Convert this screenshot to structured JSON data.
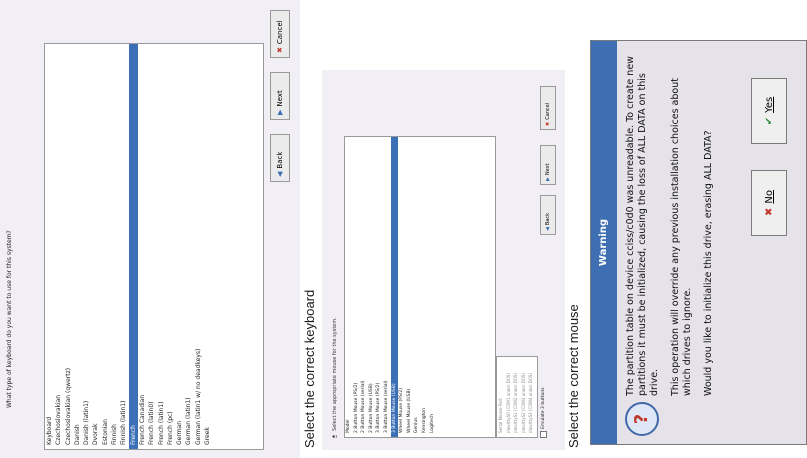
{
  "keyboard_panel": {
    "question": "What type of keyboard do you want to use for this system?",
    "items": [
      "Keyboard",
      "Czechoslovakian",
      "Czechoslovakian (qwertz)",
      "Danish",
      "Danish (latin1)",
      "Dvorak",
      "Estonian",
      "Finnish",
      "Finnish (latin1)",
      "French",
      "French Canadian",
      "French (latin0)",
      "French (latin1)",
      "French (pc)",
      "German",
      "German (latin1)",
      "German (latin1 w/ no deadkeys)",
      "Greek"
    ],
    "selected_index": 9,
    "back_label": "Back",
    "next_label": "Next",
    "cancel_label": "Cancel"
  },
  "caption_keyboard": "Select the correct keyboard",
  "mouse_panel": {
    "header": "Select the appropriate mouse for the system.",
    "items": [
      "Model",
      "2 Button Mouse (PS/2)",
      "2 Button Mouse (serial)",
      "2 Button Mouse (USB)",
      "3 Button Mouse (PS/2)",
      "3 Button Mouse (serial)",
      "3 Button Mouse (USB)",
      "Wheel Mouse (PS/2)",
      "Wheel Mouse (USB)",
      "Genius",
      "Kensington",
      "Logitech"
    ],
    "selected_index": 6,
    "device_items": [
      "Serial Mouse Port",
      "/dev/ttyS0 (COM1 under DOS)",
      "/dev/ttyS1 (COM2 under DOS)",
      "/dev/ttyS2 (COM3 under DOS)",
      "/dev/ttyS3 (COM4 under DOS)"
    ],
    "emulate_label": "Emulate 3 buttons",
    "back_label": "Back",
    "next_label": "Next",
    "cancel_label": "Cancel"
  },
  "caption_mouse": "Select the correct mouse",
  "warning_dialog": {
    "title": "Warning",
    "paragraphs": [
      "The partition table on device cciss/c0d0 was unreadable. To create new partitions it must be initialized, causing the loss of ALL DATA on this drive.",
      "This operation will override any previous installation choices about which drives to ignore.",
      "Would you like to initialize this drive, erasing ALL DATA?"
    ],
    "no_label": "No",
    "yes_label": "Yes"
  },
  "icons": {
    "question": "question-icon",
    "back": "back-arrow-icon",
    "next": "next-arrow-icon",
    "cancel": "cancel-x-icon",
    "no": "no-x-icon",
    "yes": "yes-check-icon"
  },
  "colors": {
    "selection": "#3b6fb6",
    "title_bar": "#3f6fb3",
    "panel_bg": "#f2eef5"
  }
}
